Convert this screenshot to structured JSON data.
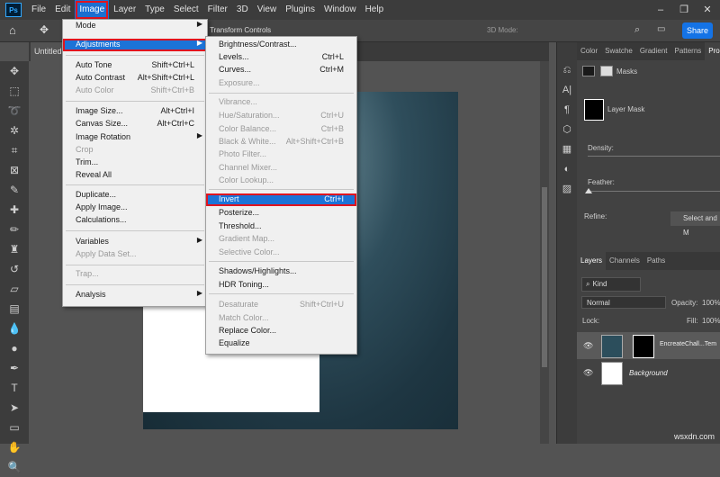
{
  "menubar": {
    "logo": "Ps",
    "items": [
      "File",
      "Edit",
      "Image",
      "Layer",
      "Type",
      "Select",
      "Filter",
      "3D",
      "View",
      "Plugins",
      "Window",
      "Help"
    ]
  },
  "optbar": {
    "transform_controls": "Transform Controls",
    "mode_3d": "3D Mode:",
    "share": "Share"
  },
  "doc_tab": "Untitled",
  "image_menu": {
    "items": [
      {
        "label": "Mode",
        "submenu": true
      },
      {
        "label": "Adjustments",
        "submenu": true
      },
      {
        "label": "Auto Tone",
        "shortcut": "Shift+Ctrl+L"
      },
      {
        "label": "Auto Contrast",
        "shortcut": "Alt+Shift+Ctrl+L"
      },
      {
        "label": "Auto Color",
        "shortcut": "Shift+Ctrl+B"
      },
      {
        "label": "Image Size...",
        "shortcut": "Alt+Ctrl+I"
      },
      {
        "label": "Canvas Size...",
        "shortcut": "Alt+Ctrl+C"
      },
      {
        "label": "Image Rotation",
        "submenu": true
      },
      {
        "label": "Crop"
      },
      {
        "label": "Trim..."
      },
      {
        "label": "Reveal All"
      },
      {
        "label": "Duplicate..."
      },
      {
        "label": "Apply Image..."
      },
      {
        "label": "Calculations..."
      },
      {
        "label": "Variables",
        "submenu": true
      },
      {
        "label": "Apply Data Set..."
      },
      {
        "label": "Trap..."
      },
      {
        "label": "Analysis",
        "submenu": true
      }
    ]
  },
  "adjust_menu": {
    "items": [
      {
        "label": "Brightness/Contrast..."
      },
      {
        "label": "Levels...",
        "shortcut": "Ctrl+L"
      },
      {
        "label": "Curves...",
        "shortcut": "Ctrl+M"
      },
      {
        "label": "Exposure..."
      },
      {
        "label": "Vibrance..."
      },
      {
        "label": "Hue/Saturation...",
        "shortcut": "Ctrl+U"
      },
      {
        "label": "Color Balance...",
        "shortcut": "Ctrl+B"
      },
      {
        "label": "Black & White...",
        "shortcut": "Alt+Shift+Ctrl+B"
      },
      {
        "label": "Photo Filter..."
      },
      {
        "label": "Channel Mixer..."
      },
      {
        "label": "Color Lookup..."
      },
      {
        "label": "Invert",
        "shortcut": "Ctrl+I"
      },
      {
        "label": "Posterize..."
      },
      {
        "label": "Threshold..."
      },
      {
        "label": "Gradient Map..."
      },
      {
        "label": "Selective Color..."
      },
      {
        "label": "Shadows/Highlights..."
      },
      {
        "label": "HDR Toning..."
      },
      {
        "label": "Desaturate",
        "shortcut": "Shift+Ctrl+U"
      },
      {
        "label": "Match Color..."
      },
      {
        "label": "Replace Color..."
      },
      {
        "label": "Equalize"
      }
    ]
  },
  "properties": {
    "tabs": [
      "Color",
      "Swatche",
      "Gradient",
      "Patterns",
      "Prop"
    ],
    "masks": "Masks",
    "layer_mask": "Layer Mask",
    "density": "Density:",
    "feather": "Feather:",
    "refine": "Refine:",
    "select_mask": "Select and M"
  },
  "layers": {
    "tabs": [
      "Layers",
      "Channels",
      "Paths"
    ],
    "kind": "Kind",
    "blend": "Normal",
    "opacity_label": "Opacity:",
    "opacity": "100%",
    "lock": "Lock:",
    "fill_label": "Fill:",
    "fill": "100%",
    "rows": [
      {
        "name": "EncreateChall...Tem"
      },
      {
        "name": "Background"
      }
    ]
  },
  "watermark": "wsxdn.com"
}
